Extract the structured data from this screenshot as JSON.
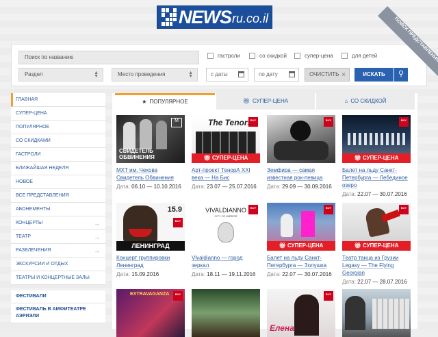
{
  "logo": {
    "main": "NEWS",
    "domain": "ru.co.il"
  },
  "search": {
    "name_placeholder": "Поиск по названию",
    "checks": [
      "гастроли",
      "со скидкой",
      "супер-цена",
      "для детей"
    ],
    "section": "Раздел",
    "venue": "Место проведения",
    "from": "с даты",
    "to": "по дату",
    "clear": "ОЧИСТИТЬ",
    "search_btn": "ИСКАТЬ",
    "ribbon": "ПОИСК ПРЕДСТАВЛЕНИЯ"
  },
  "sidebar": {
    "items": [
      "Главная",
      "Супер-цена",
      "Популярное",
      "Со скидками",
      "Гастроли",
      "Ближайшая неделя",
      "Новое",
      "Все представления",
      "Абонементы",
      "Концерты",
      "Театр",
      "Развлечения",
      "Экскурсии и отдых",
      "Театры и концертные залы"
    ],
    "festivals": [
      "ФЕСТИВАЛИ",
      "ФЕСТИВАЛЬ В АМФИТЕАТРЕ АЭРИЭЛИ"
    ]
  },
  "tabs": [
    "ПОПУЛЯРНОЕ",
    "СУПЕР-ЦЕНА",
    "СО СКИДКОЙ"
  ],
  "date_label": "Дата:",
  "super_label": "СУПЕР-ЦЕНА",
  "events": [
    {
      "title": "МХТ им. Чехова Свидетель Обвинения",
      "date": "06.10 — 10.10.2016",
      "poster": "СВИДЕТЕЛЬ ОБВИНЕНИЯ",
      "super": false
    },
    {
      "title": "Арт-проект ТенорА XXI века — На Бис",
      "date": "23.07 — 25.07.2016",
      "poster": "The Tenors",
      "super": true
    },
    {
      "title": "Земфира — самая известная рок-певица",
      "date": "29.09 — 30.09.2016",
      "poster": "",
      "super": false
    },
    {
      "title": "Балет на льду Санкт-Петербурга — Лебединое озеро",
      "date": "22.07 — 30.07.2016",
      "poster": "",
      "super": true
    },
    {
      "title": "Концерт группировки Ленинград",
      "date": "15.09.2016",
      "poster": "ЛЕНИНГРАД",
      "super": false
    },
    {
      "title": "Vlvaldianno — город зеркал",
      "date": "18.11 — 19.11.2016",
      "poster": "VIVALDIANNO",
      "super": false
    },
    {
      "title": "Балет на льду Санкт-Петербурга — Золушка",
      "date": "22.07 — 30.07.2016",
      "poster": "",
      "super": true
    },
    {
      "title": "Театр танца из Грузии Legasy — The Flying Georgian",
      "date": "22.07 — 28.07.2016",
      "poster": "",
      "super": true
    },
    {
      "title": "",
      "date": "",
      "poster": "EXTRAVAGANZA",
      "super": false
    },
    {
      "title": "",
      "date": "",
      "poster": "",
      "super": false
    },
    {
      "title": "",
      "date": "",
      "poster": "Елена",
      "super": false
    },
    {
      "title": "",
      "date": "",
      "poster": "",
      "super": false
    }
  ]
}
